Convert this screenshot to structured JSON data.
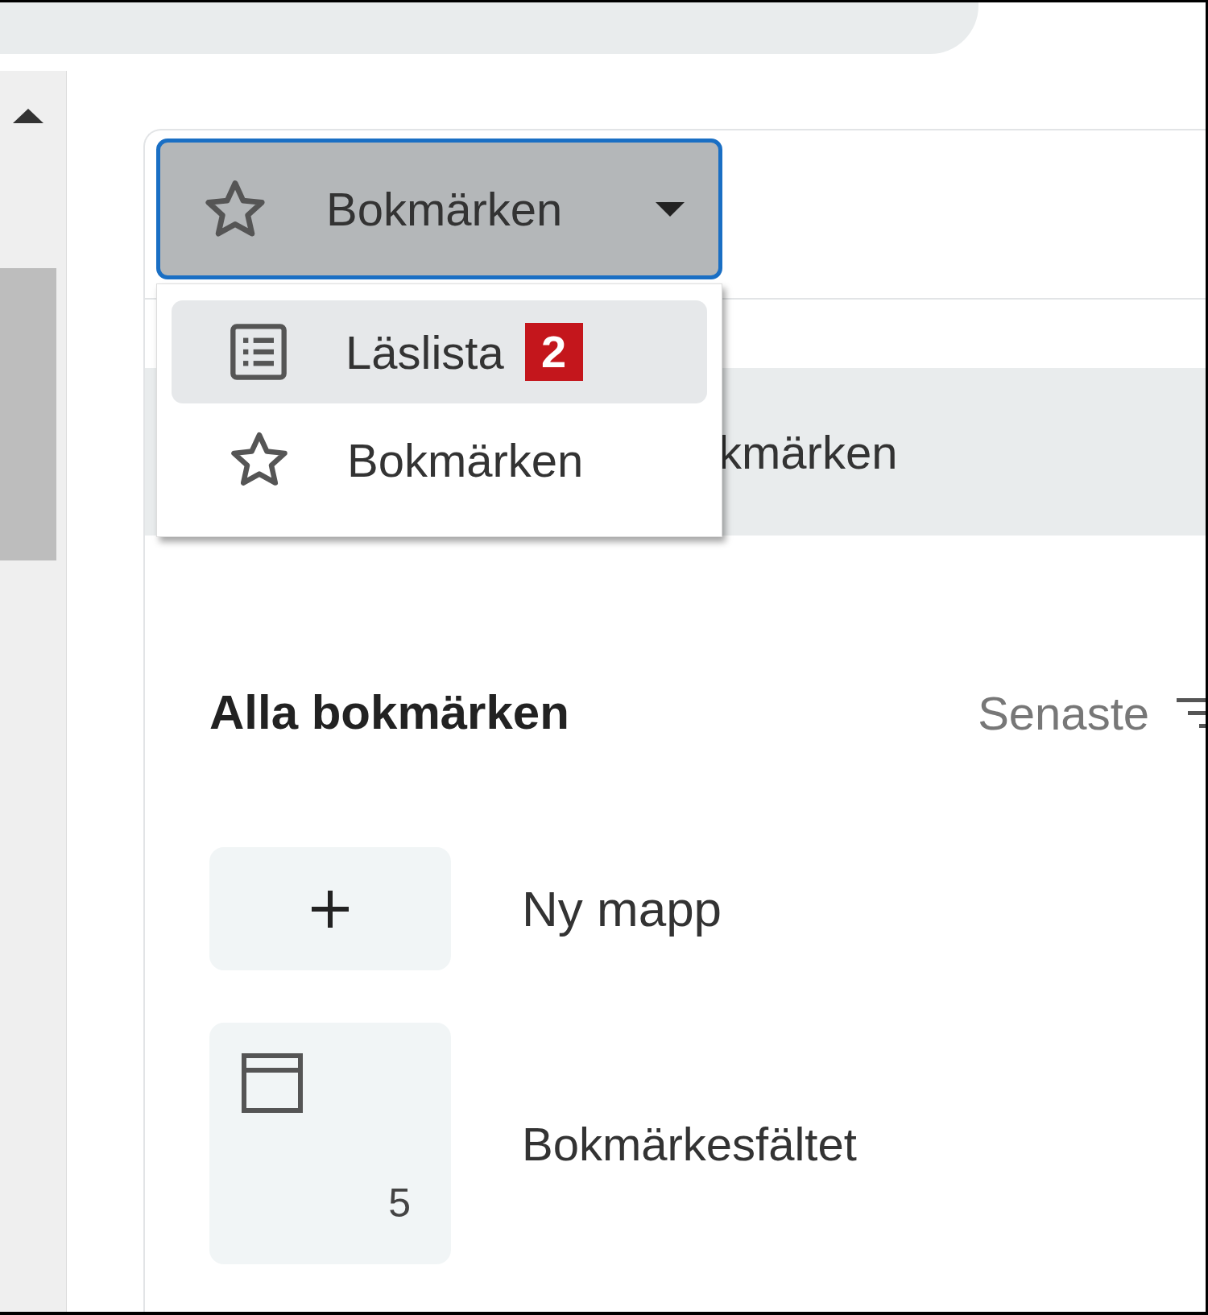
{
  "dropdown": {
    "label": "Bokmärken",
    "expanded": true
  },
  "menu": {
    "items": [
      {
        "kind": "list",
        "label": "Läslista",
        "badge": "2",
        "selected": true
      },
      {
        "kind": "star",
        "label": "Bokmärken",
        "selected": false
      }
    ]
  },
  "background_item": {
    "label": "kmärken"
  },
  "section": {
    "title": "Alla bokmärken",
    "sort": "Senaste"
  },
  "items": [
    {
      "kind": "new",
      "label": "Ny mapp"
    },
    {
      "kind": "folder",
      "label": "Bokmärkesfältet",
      "count": "5"
    }
  ]
}
